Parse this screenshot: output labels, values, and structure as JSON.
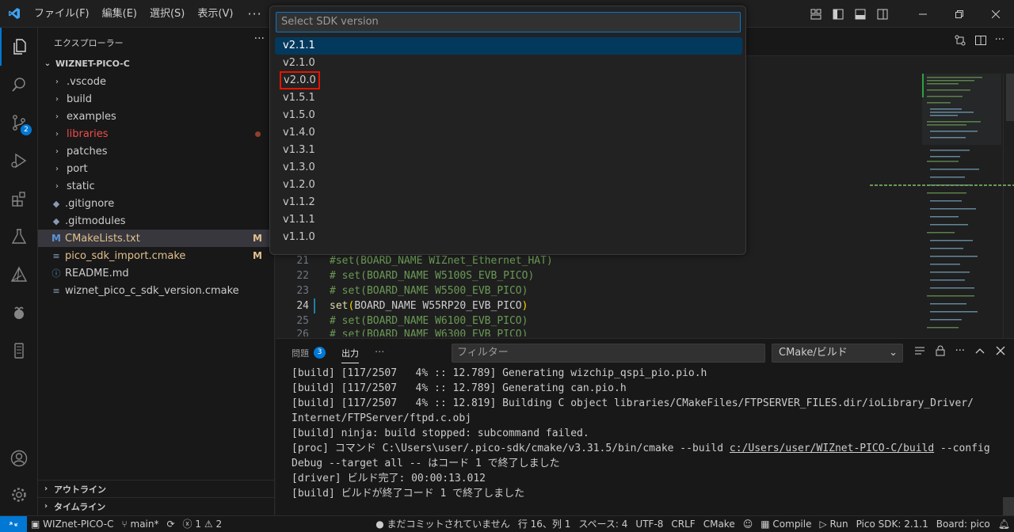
{
  "menu": [
    "ファイル(F)",
    "編集(E)",
    "選択(S)",
    "表示(V)"
  ],
  "menu_more": "···",
  "activity": {
    "scm_badge": "2"
  },
  "explorer": {
    "title": "エクスプローラー",
    "more": "···",
    "project": "WIZNET-PICO-C",
    "folders": [
      ".vscode",
      "build",
      "examples",
      "libraries",
      "patches",
      "port",
      "static"
    ],
    "files": [
      ".gitignore",
      ".gitmodules",
      "CMakeLists.txt",
      "pico_sdk_import.cmake",
      "README.md",
      "wiznet_pico_c_sdk_version.cmake"
    ],
    "git_status": {
      "cmakelists": "M",
      "pico_sdk_import": "M"
    },
    "outline": "アウトライン",
    "timeline": "タイムライン"
  },
  "quickpick": {
    "placeholder": "Select SDK version",
    "items": [
      "v2.1.1",
      "v2.1.0",
      "v2.0.0",
      "v1.5.1",
      "v1.5.0",
      "v1.4.0",
      "v1.3.1",
      "v1.3.0",
      "v1.2.0",
      "v1.1.2",
      "v1.1.1",
      "v1.1.0"
    ],
    "selected_index": 0,
    "highlighted_index": 2
  },
  "code": {
    "lines": [
      {
        "num": "21",
        "text": "#set(BOARD_NAME WIZnet_Ethernet_HAT)",
        "kind": "comment"
      },
      {
        "num": "22",
        "text": "# set(BOARD_NAME W5100S_EVB_PICO)",
        "kind": "comment"
      },
      {
        "num": "23",
        "text": "# set(BOARD_NAME W5500_EVB_PICO)",
        "kind": "comment"
      },
      {
        "num": "24",
        "fn": "set",
        "args": "BOARD_NAME W55RP20_EVB_PICO",
        "kind": "code"
      },
      {
        "num": "25",
        "text": "# set(BOARD_NAME W6100_EVB_PICO)",
        "kind": "comment"
      },
      {
        "num": "26",
        "text": "# set(BOARD_NAME W6300_EVB_PICO)",
        "kind": "comment"
      }
    ]
  },
  "panel": {
    "tab_problems": "問題",
    "problems_count": "3",
    "tab_output": "出力",
    "more": "···",
    "filter_placeholder": "フィルター",
    "channel": "CMake/ビルド",
    "output_lines": [
      "[build] [117/2507   4% :: 12.789] Generating wizchip_qspi_pio.pio.h",
      "[build] [117/2507   4% :: 12.789] Generating can.pio.h",
      "[build] [117/2507   4% :: 12.819] Building C object libraries/CMakeFiles/FTPSERVER_FILES.dir/ioLibrary_Driver/",
      "Internet/FTPServer/ftpd.c.obj",
      "[build] ninja: build stopped: subcommand failed."
    ],
    "proc_prefix": "[proc] コマンド C:\\Users\\user/.pico-sdk/cmake/v3.31.5/bin/cmake --build ",
    "proc_link": "c:/Users/user/WIZnet-PICO-C/build",
    "proc_suffix": " --config",
    "output_lines_2": [
      "Debug --target all -- はコード 1 で終了しました",
      "[driver] ビルド完了: 00:00:13.012",
      "[build] ビルドが終了コード 1 で終了しました"
    ]
  },
  "status": {
    "repo": "WIZnet-PICO-C",
    "branch": "main*",
    "errors": "1",
    "warnings": "2",
    "commit": "まだコミットされていません",
    "position": "行 16、列 1",
    "spaces": "スペース: 4",
    "encoding": "UTF-8",
    "eol": "CRLF",
    "language": "CMake",
    "compile": "Compile",
    "run": "Run",
    "sdk": "Pico SDK: 2.1.1",
    "board": "Board: pico"
  },
  "colors": {
    "accent": "#0078d4",
    "highlight_box": "#e51400",
    "modified": "#e2c08d"
  }
}
